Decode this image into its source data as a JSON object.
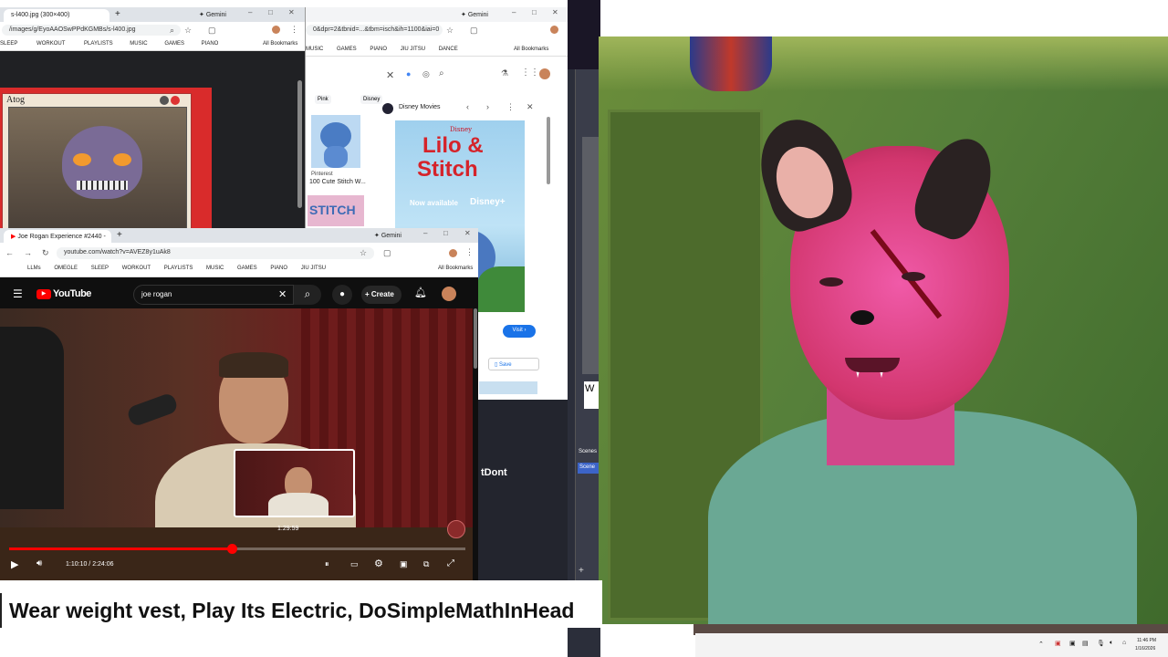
{
  "win1": {
    "tab_title": "s-l400.jpg (300×400)",
    "new_tab": "+",
    "gemini": "Gemini",
    "url": "/images/g/EyoAAOSwPPdKGMBs/s-l400.jpg",
    "bookmarks": [
      "SLEEP",
      "WORKOUT",
      "PLAYLISTS",
      "MUSIC",
      "GAMES",
      "PIANO"
    ],
    "all_bookmarks": "All Bookmarks",
    "card_name": "Atog"
  },
  "win2": {
    "gemini": "Gemini",
    "url": "0&dpr=2&tbnid=...&tbm=isch&ih=1100&iai=0",
    "bookmarks": [
      "MUSIC",
      "GAMES",
      "PIANO",
      "JIU JITSU",
      "DANCE"
    ],
    "all_bookmarks": "All Bookmarks",
    "chips": [
      "Pink",
      "Disney"
    ],
    "result_source": "Pinterest",
    "result_title": "100 Cute Stitch W...",
    "thumb2_text": "STITCH",
    "panel_source": "Disney Movies",
    "poster_brand": "Disney",
    "poster_title_1": "Lilo &",
    "poster_title_2": "Stitch",
    "poster_sub": "Now available",
    "poster_plus": "Disney+",
    "visit": "Visit",
    "save": "Save"
  },
  "win3": {
    "tab_title": "Joe Rogan Experience #2440 -",
    "new_tab": "+",
    "gemini": "Gemini",
    "url": "youtube.com/watch?v=AVEZ8y1uAk8",
    "bookmarks": [
      "LLMs",
      "OMEGLE",
      "SLEEP",
      "WORKOUT",
      "PLAYLISTS",
      "MUSIC",
      "GAMES",
      "PIANO",
      "JIU JITSU"
    ],
    "all_bookmarks": "All Bookmarks",
    "logo": "YouTube",
    "search_value": "joe rogan",
    "create": "Create",
    "preview_time": "1:29:59",
    "time_display": "1:10:10 / 2:24:06",
    "progress": 0.487
  },
  "bg": {
    "dont_text": "tDont",
    "scene_labels": [
      "Scenes",
      "Scene"
    ],
    "w_label": "W"
  },
  "caption": "Wear weight vest, Play Its Electric, DoSimpleMathInHead",
  "taskbar": {
    "time": "11:46 PM",
    "date": "1/16/2026"
  },
  "colors": {
    "yt_red": "#ff0000",
    "chrome_tabbar": "#dfe3e8",
    "shirt": "#6aa894",
    "wall": "#5f8c3c"
  }
}
